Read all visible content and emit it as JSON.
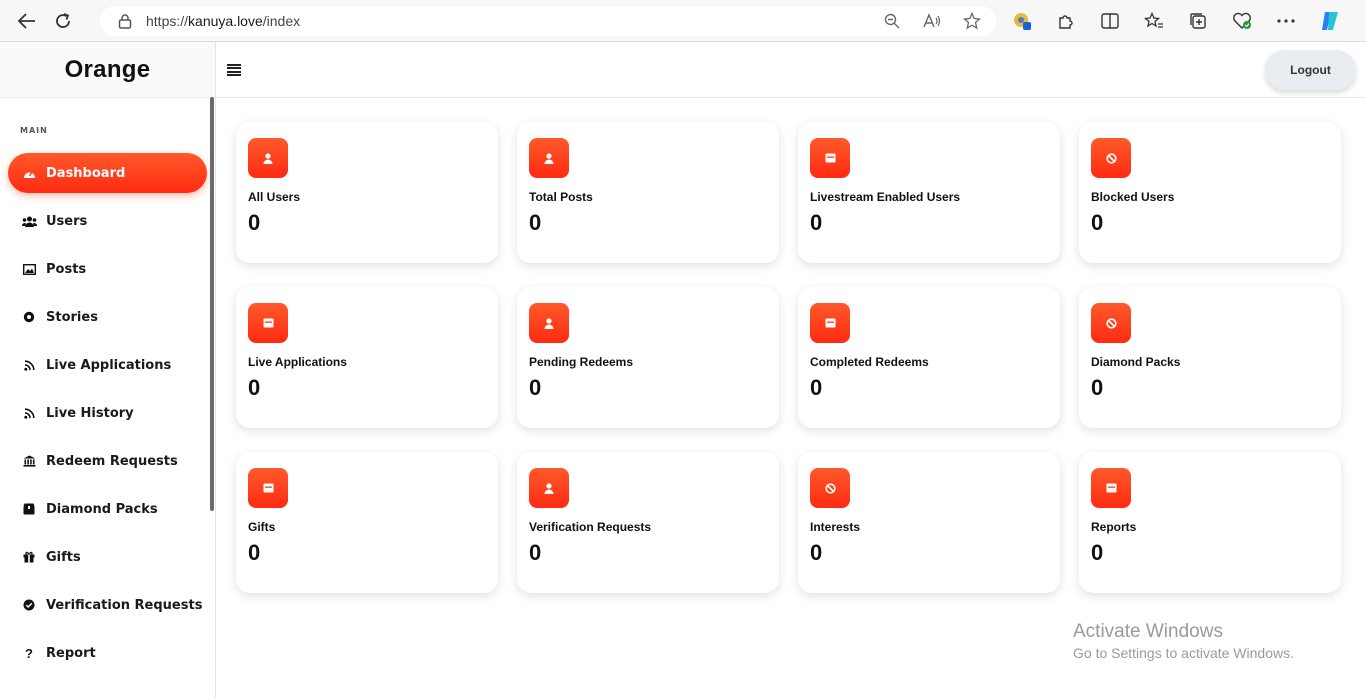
{
  "browser": {
    "url_prefix": "https://",
    "url_host": "kanuya.love",
    "url_path": "/index"
  },
  "sidebar": {
    "brand": "Orange",
    "section_label": "MAIN",
    "items": [
      {
        "label": "Dashboard",
        "icon": "gauge-icon",
        "active": true
      },
      {
        "label": "Users",
        "icon": "users-icon"
      },
      {
        "label": "Posts",
        "icon": "image-icon"
      },
      {
        "label": "Stories",
        "icon": "circle-dot-icon"
      },
      {
        "label": "Live Applications",
        "icon": "rss-icon"
      },
      {
        "label": "Live History",
        "icon": "rss-icon"
      },
      {
        "label": "Redeem Requests",
        "icon": "bank-icon"
      },
      {
        "label": "Diamond Packs",
        "icon": "box-icon"
      },
      {
        "label": "Gifts",
        "icon": "gift-icon"
      },
      {
        "label": "Verification Requests",
        "icon": "check-circle-icon"
      },
      {
        "label": "Report",
        "icon": "question-icon"
      }
    ]
  },
  "topbar": {
    "logout_label": "Logout"
  },
  "cards": [
    {
      "label": "All Users",
      "value": "0",
      "icon": "user-icon"
    },
    {
      "label": "Total Posts",
      "value": "0",
      "icon": "user-icon"
    },
    {
      "label": "Livestream Enabled Users",
      "value": "0",
      "icon": "calendar-icon"
    },
    {
      "label": "Blocked Users",
      "value": "0",
      "icon": "ban-icon"
    },
    {
      "label": "Live Applications",
      "value": "0",
      "icon": "calendar-icon"
    },
    {
      "label": "Pending Redeems",
      "value": "0",
      "icon": "user-icon"
    },
    {
      "label": "Completed Redeems",
      "value": "0",
      "icon": "calendar-icon"
    },
    {
      "label": "Diamond Packs",
      "value": "0",
      "icon": "ban-icon"
    },
    {
      "label": "Gifts",
      "value": "0",
      "icon": "calendar-icon"
    },
    {
      "label": "Verification Requests",
      "value": "0",
      "icon": "user-icon"
    },
    {
      "label": "Interests",
      "value": "0",
      "icon": "ban-icon"
    },
    {
      "label": "Reports",
      "value": "0",
      "icon": "calendar-icon"
    }
  ],
  "watermark": {
    "title": "Activate Windows",
    "subtitle": "Go to Settings to activate Windows."
  },
  "colors": {
    "accent": "#ff3a1a",
    "logout_bg": "#e9edf2"
  }
}
